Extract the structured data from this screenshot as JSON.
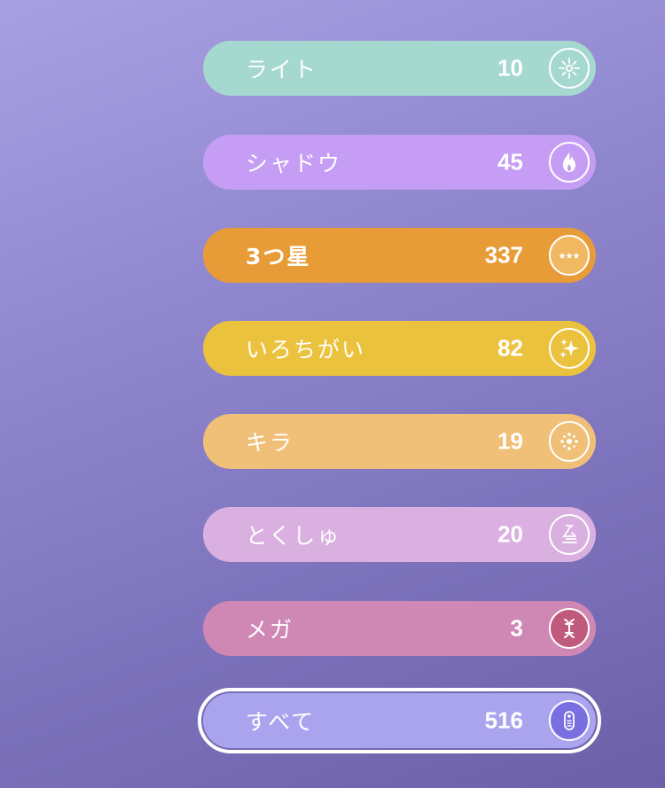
{
  "filters": [
    {
      "label": "ライト",
      "count": "10",
      "color": "#a5d8cf",
      "icon": "lure-burst-icon"
    },
    {
      "label": "シャドウ",
      "count": "45",
      "color": "#c59df5",
      "icon": "shadow-flame-icon"
    },
    {
      "label": "3つ星",
      "count": "337",
      "color": "#e89c38",
      "icon": "three-star-icon"
    },
    {
      "label": "いろちがい",
      "count": "82",
      "color": "#ebc23e",
      "icon": "shiny-sparkle-icon"
    },
    {
      "label": "キラ",
      "count": "19",
      "color": "#f0c078",
      "icon": "lucky-sparkle-icon"
    },
    {
      "label": "とくしゅ",
      "count": "20",
      "color": "#d9b0e0",
      "icon": "special-swirl-icon"
    },
    {
      "label": "メガ",
      "count": "3",
      "color": "#cf88b4",
      "icon": "mega-dna-icon"
    },
    {
      "label": "すべて",
      "count": "516",
      "color": "#aaa4ee",
      "icon": "pokedex-icon",
      "selected": true
    }
  ]
}
